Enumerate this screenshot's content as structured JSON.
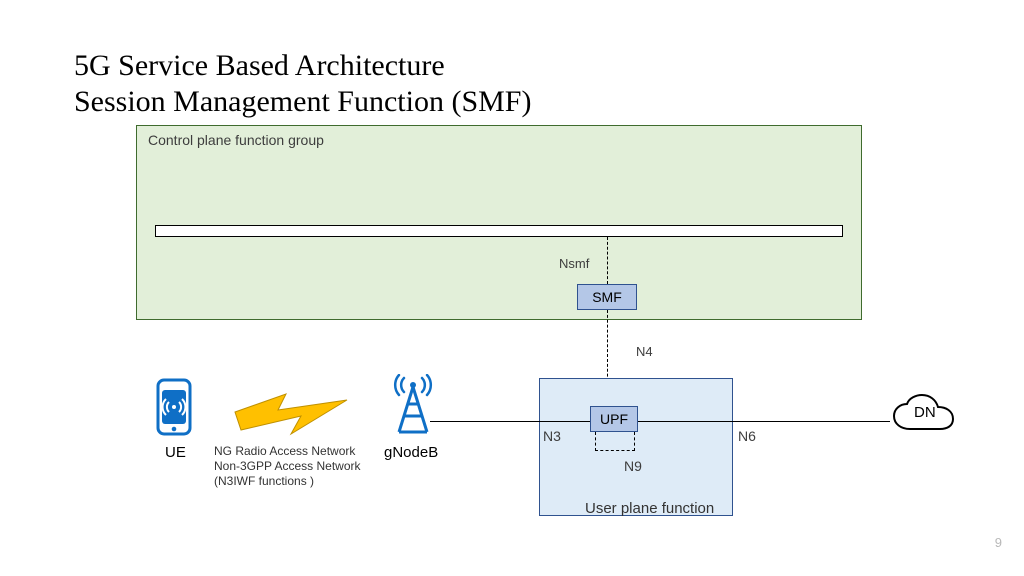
{
  "title_line1": "5G Service Based Architecture",
  "title_line2": "Session Management Function (SMF)",
  "ctrl_group_label": "Control plane function group",
  "smf_block": "SMF",
  "nsmf_label": "Nsmf",
  "n4_label": "N4",
  "user_plane_label": "User plane function",
  "upf_block": "UPF",
  "n9_label": "N9",
  "n3_label": "N3",
  "n6_label": "N6",
  "dn_label": "DN",
  "ue_label": "UE",
  "gnb_label": "gNodeB",
  "ran_line1": "NG Radio Access Network",
  "ran_line2": "Non-3GPP Access Network",
  "ran_line3": "(N3IWF functions )",
  "page_number": "9",
  "colors": {
    "ctrl_bg": "#e2efd9",
    "node_bg": "#b4c7e7",
    "upf_bg": "#deebf7",
    "accent_blue": "#2f528f",
    "bolt": "#ffc000",
    "icon_blue": "#0f6fc6"
  }
}
